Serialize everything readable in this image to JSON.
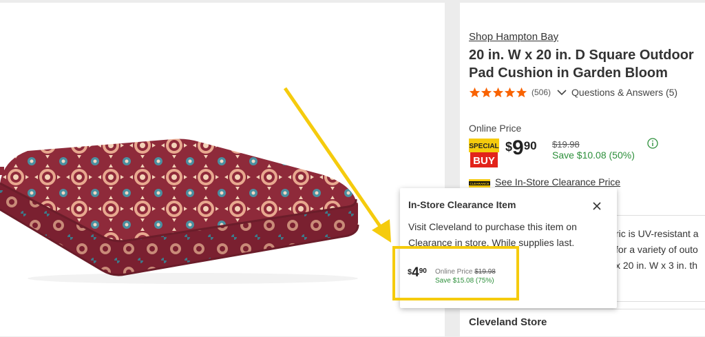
{
  "product": {
    "brand": "Shop Hampton Bay",
    "title_line1": "20 in. W x 20 in. D Square Outdoor",
    "title_line2": "Pad Cushion in Garden Bloom",
    "rating": 5,
    "review_count": "(506)",
    "qa_label": "Questions & Answers (5)"
  },
  "pricing": {
    "online_label": "Online Price",
    "special_buy_top": "SPECIAL",
    "special_buy_bottom": "BUY",
    "dollar": "$",
    "whole": "9",
    "cents": "90",
    "was": "$19.98",
    "save": "Save $10.08 (50%)",
    "clearance_tag": "CLEARANCE",
    "clearance_link": "See In-Store Clearance Price"
  },
  "description": {
    "line1": "ric is UV-resistant a",
    "line2": "for a variety of outo",
    "line3": "x 20 in. W x 3 in. th"
  },
  "store": {
    "name": "Cleveland Store"
  },
  "popup": {
    "title": "In-Store Clearance Item",
    "body": "Visit Cleveland to purchase this item on Clearance in store. While supplies last.",
    "dollar": "$",
    "whole": "4",
    "cents": "90",
    "online_label": "Online Price",
    "was": "$19.98",
    "save": "Save $15.08 (75%)"
  },
  "colors": {
    "accent_orange": "#f96302",
    "save_green": "#2c8f3a",
    "highlight_yellow": "#f5cb0d",
    "cushion_red": "#8e2a3a"
  }
}
